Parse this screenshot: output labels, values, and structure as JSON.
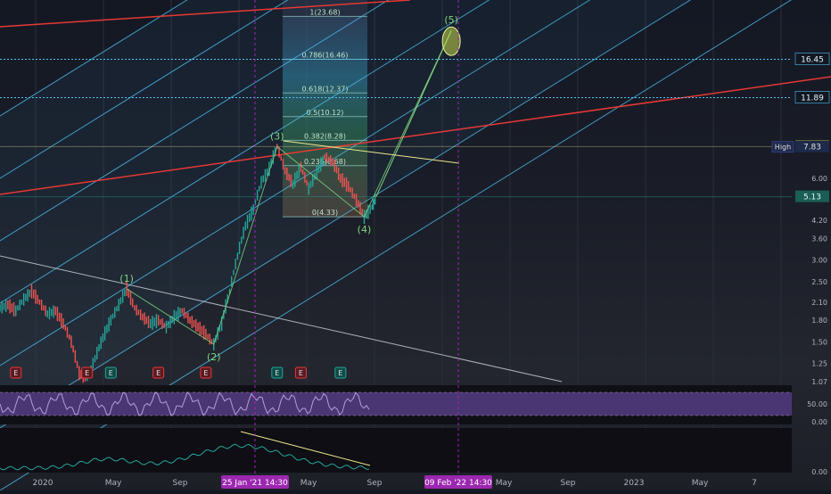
{
  "colors": {
    "background": "#131722",
    "channel": "#4fc3f7",
    "fib_fill": "#2a6f8f",
    "fib_text": "#c8e6c9",
    "wave_label": "#7fd67f",
    "red_line": "#e53935",
    "white_line": "#d1d4dc",
    "rsi_band": "#7e57c2",
    "rsi_line": "#b39ddb",
    "indicator_line": "#26a69a",
    "yellow": "#f0e68c",
    "price_up": "#26a69a",
    "price_down": "#ef5350",
    "time_badge": "#9c27b0"
  },
  "chart_data": {
    "type": "line",
    "yscale": "log",
    "ylim": [
      1.07,
      26.0
    ],
    "price_axis_ticks": [
      "1.07",
      "1.25",
      "1.50",
      "1.80",
      "2.10",
      "2.50",
      "3.00",
      "3.60",
      "4.20",
      "5.13",
      "6.00",
      "7.83",
      "11.89",
      "16.45"
    ],
    "price_tags": [
      {
        "label": "16.45",
        "value": 16.45,
        "style": "dotted-cyan"
      },
      {
        "label": "11.89",
        "value": 11.89,
        "style": "dotted-cyan"
      },
      {
        "label": "7.85",
        "value": 7.85,
        "style": "yellow"
      },
      {
        "label": "7.83",
        "value": 7.83,
        "style": "high",
        "prefix": "High"
      },
      {
        "label": "5.13",
        "value": 5.13,
        "style": "teal"
      }
    ],
    "time_axis_labels": [
      "2020",
      "May",
      "Sep",
      "25 Jan '21   14:30",
      "May",
      "Sep",
      "09 Feb '22   14:30",
      "May",
      "Sep",
      "2023",
      "May",
      "7"
    ],
    "fib_levels": [
      {
        "label": "1(23.68)",
        "value": 23.68
      },
      {
        "label": "0.786(16.46)",
        "value": 16.46
      },
      {
        "label": "0.618(12.37)",
        "value": 12.37
      },
      {
        "label": "0.5(10.12)",
        "value": 10.12
      },
      {
        "label": "0.382(8.28)",
        "value": 8.28
      },
      {
        "label": "0.236(6.68)",
        "value": 6.68
      },
      {
        "label": "0(4.33)",
        "value": 4.33
      }
    ],
    "wave_labels": [
      "(1)",
      "(2)",
      "(3)",
      "(4)",
      "(5)"
    ],
    "waves": [
      {
        "label": "(1)",
        "t": 0.16,
        "value": 2.35
      },
      {
        "label": "(2)",
        "t": 0.27,
        "value": 1.47
      },
      {
        "label": "(3)",
        "t": 0.35,
        "value": 7.85
      },
      {
        "label": "(4)",
        "t": 0.46,
        "value": 4.33
      },
      {
        "label": "(5)",
        "t": 0.57,
        "value": 21.0
      }
    ],
    "price_path": [
      [
        0.0,
        2.0
      ],
      [
        0.01,
        2.05
      ],
      [
        0.02,
        1.95
      ],
      [
        0.03,
        2.15
      ],
      [
        0.04,
        2.3
      ],
      [
        0.05,
        2.1
      ],
      [
        0.06,
        1.9
      ],
      [
        0.07,
        1.95
      ],
      [
        0.08,
        1.75
      ],
      [
        0.09,
        1.5
      ],
      [
        0.1,
        1.15
      ],
      [
        0.11,
        1.1
      ],
      [
        0.12,
        1.3
      ],
      [
        0.13,
        1.55
      ],
      [
        0.14,
        1.8
      ],
      [
        0.15,
        2.05
      ],
      [
        0.16,
        2.35
      ],
      [
        0.17,
        2.0
      ],
      [
        0.18,
        1.85
      ],
      [
        0.19,
        1.75
      ],
      [
        0.2,
        1.8
      ],
      [
        0.21,
        1.7
      ],
      [
        0.22,
        1.85
      ],
      [
        0.23,
        1.95
      ],
      [
        0.24,
        1.8
      ],
      [
        0.25,
        1.7
      ],
      [
        0.26,
        1.6
      ],
      [
        0.27,
        1.47
      ],
      [
        0.28,
        1.75
      ],
      [
        0.29,
        2.3
      ],
      [
        0.3,
        3.1
      ],
      [
        0.31,
        4.0
      ],
      [
        0.32,
        4.6
      ],
      [
        0.33,
        5.8
      ],
      [
        0.34,
        6.5
      ],
      [
        0.35,
        7.85
      ],
      [
        0.36,
        6.4
      ],
      [
        0.37,
        5.7
      ],
      [
        0.38,
        6.6
      ],
      [
        0.39,
        5.5
      ],
      [
        0.4,
        6.3
      ],
      [
        0.41,
        7.2
      ],
      [
        0.42,
        6.9
      ],
      [
        0.43,
        6.0
      ],
      [
        0.44,
        5.6
      ],
      [
        0.45,
        5.0
      ],
      [
        0.46,
        4.33
      ],
      [
        0.47,
        4.7
      ],
      [
        0.475,
        5.13
      ]
    ],
    "projection": [
      [
        0.475,
        5.13
      ],
      [
        0.57,
        21.0
      ]
    ],
    "e_markers": [
      {
        "t": 0.02,
        "kind": "red"
      },
      {
        "t": 0.11,
        "kind": "red"
      },
      {
        "t": 0.14,
        "kind": "teal"
      },
      {
        "t": 0.2,
        "kind": "red"
      },
      {
        "t": 0.26,
        "kind": "red"
      },
      {
        "t": 0.35,
        "kind": "teal"
      },
      {
        "t": 0.38,
        "kind": "red"
      },
      {
        "t": 0.43,
        "kind": "teal"
      }
    ],
    "e_label": "E",
    "rsi_ticks": [
      "50.00",
      "0.00"
    ],
    "osc_ticks": [
      "0.00"
    ]
  }
}
